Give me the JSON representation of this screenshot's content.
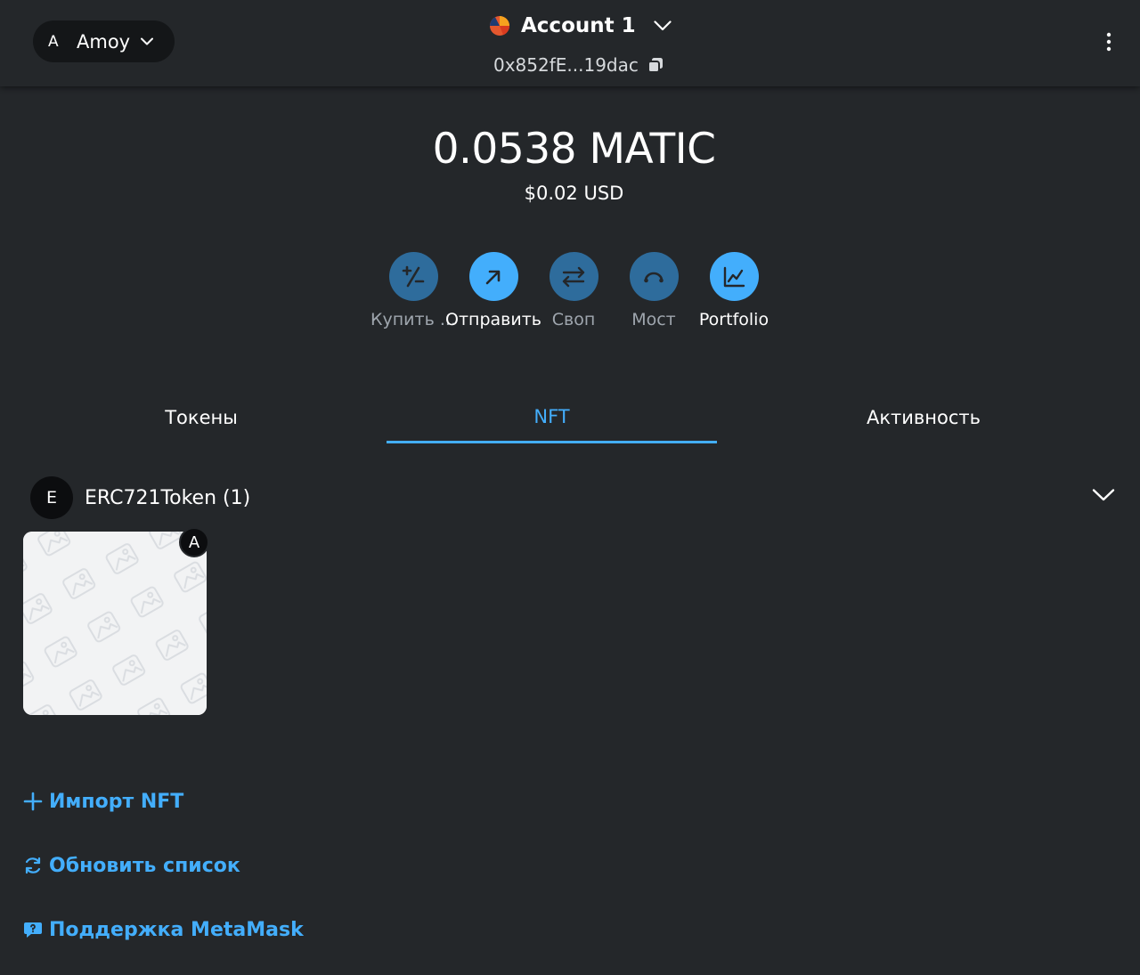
{
  "header": {
    "network": {
      "avatar_letter": "A",
      "name": "Amoy"
    },
    "account": {
      "name": "Account 1",
      "address": "0x852fE...19dac"
    }
  },
  "balance": {
    "native": "0.0538 MATIC",
    "fiat": "$0.02 USD"
  },
  "actions": [
    {
      "label": "Купить ...",
      "icon": "buy-sell-icon",
      "enabled": false
    },
    {
      "label": "Отправить",
      "icon": "send-arrow-icon",
      "enabled": true
    },
    {
      "label": "Своп",
      "icon": "swap-icon",
      "enabled": false
    },
    {
      "label": "Мост",
      "icon": "bridge-icon",
      "enabled": false
    },
    {
      "label": "Portfolio",
      "icon": "portfolio-chart-icon",
      "enabled": true
    }
  ],
  "tabs": [
    {
      "label": "Токены",
      "active": false
    },
    {
      "label": "NFT",
      "active": true
    },
    {
      "label": "Активность",
      "active": false
    }
  ],
  "collection": {
    "avatar_letter": "E",
    "name": "ERC721Token (1)"
  },
  "nft": {
    "badge_letter": "A"
  },
  "links": {
    "import_nft": "Импорт NFT",
    "refresh_list": "Обновить список",
    "support": "Поддержка MetaMask"
  },
  "colors": {
    "background": "#24272a",
    "accent": "#43aefc",
    "accent_dim": "#2e6c9c",
    "muted_text": "#9fa6ae"
  }
}
